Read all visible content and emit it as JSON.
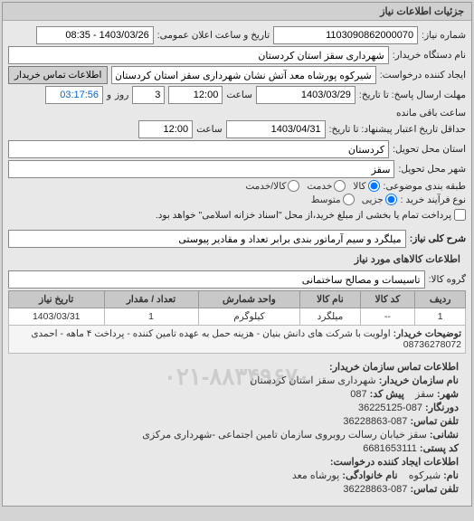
{
  "panel_title": "جزئیات اطلاعات نیاز",
  "labels": {
    "need_number": "شماره نیاز:",
    "public_datetime": "تاریخ و ساعت اعلان عمومی:",
    "buyer_device_name": "نام دستگاه خریدار:",
    "requester": "ایجاد کننده درخواست:",
    "buyer_contact_btn": "اطلاعات تماس خریدار",
    "response_deadline": "مهلت ارسال پاسخ: تا تاریخ:",
    "validity_minimum": "حداقل تاریخ اعتبار پیشنهاد: تا تاریخ:",
    "hour": "ساعت",
    "and": "و",
    "day": "روز",
    "remaining": "ساعت باقی مانده",
    "delivery_province": "استان محل تحویل:",
    "delivery_city": "شهر محل تحویل:",
    "subject_classification": "طبقه بندی موضوعی:",
    "goods": "کالا",
    "service": "خدمت",
    "goods_service": "کالا/خدمت",
    "purchase_process_type": "نوع فرآیند خرید :",
    "partial": "جزیی",
    "medium": "متوسط",
    "purchase_note": "پرداخت تمام یا بخشی از مبلغ خرید،از محل \"اسناد خزانه اسلامی\" خواهد بود.",
    "need_general_desc": "شرح کلی نیاز:",
    "goods_info_title": "اطلاعات کالاهای مورد نیاز",
    "goods_group": "گروه کالا:",
    "buyer_remarks": "توضیحات خریدار:",
    "contact_info_title": "اطلاعات تماس سازمان خریدار:",
    "org_name": "نام سازمان خریدار:",
    "city": "شهر:",
    "prefix": "پیش کد:",
    "fax": "دورنگار:",
    "phone": "تلفن تماس:",
    "address": "نشانی:",
    "postal_code": "کد پستی:",
    "requester_info_title": "اطلاعات ایجاد کننده درخواست:",
    "name": "نام:",
    "family": "نام خانوادگی:"
  },
  "values": {
    "need_number": "1103090862000070",
    "public_datetime": "1403/03/26 - 08:35",
    "buyer_device_name": "شهرداری سقز استان کردستان",
    "requester": "شیرکوه پورشاه معد آتش نشان شهرداری سقز استان کردستان",
    "response_date": "1403/03/29",
    "response_hour": "12:00",
    "remaining_days": "3",
    "remaining_time": "03:17:56",
    "validity_date": "1403/04/31",
    "validity_hour": "12:00",
    "delivery_province": "کردستان",
    "delivery_city": "سقز",
    "need_desc": "میلگرد و سیم آرماتور بندی برابر تعداد و مقادیر پیوستی",
    "goods_group": "تاسیسات و مصالح ساختمانی",
    "buyer_remarks": "اولویت با شرکت های دانش بنیان - هزینه حمل به عهده تامین کننده - پرداخت ۴ ماهه - احمدی 08736278072"
  },
  "table": {
    "headers": {
      "row": "ردیف",
      "code": "کد کالا",
      "name": "نام کالا",
      "unit": "واحد شمارش",
      "qty": "تعداد / مقدار",
      "date": "تاریخ نیاز"
    },
    "rows": [
      {
        "row": "1",
        "code": "--",
        "name": "میلگرد",
        "unit": "کیلوگرم",
        "qty": "1",
        "date": "1403/03/31"
      }
    ]
  },
  "contact": {
    "org_name": "شهرداری سقز استان کردستان",
    "city": "سقز",
    "prefix": "087",
    "fax": "087-36225125",
    "phone": "087-36228863",
    "address": "سقز خیابان رسالت روبروی سازمان تامین اجتماعی -شهرداری مرکزی",
    "postal_code": "6681653111",
    "req_name": "شیرکوه",
    "req_family": "پورشاه معد",
    "req_phone": "087-36228863"
  },
  "watermark": "۰۲۱-۸۸۳۴۹۶۷۰"
}
